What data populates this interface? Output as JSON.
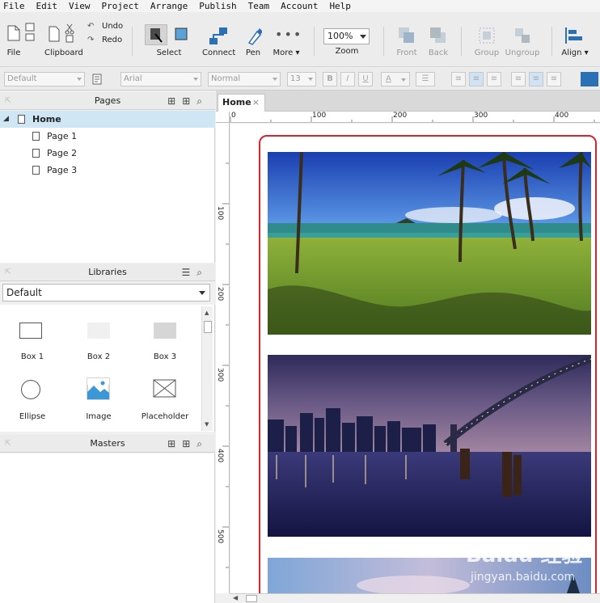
{
  "menu": [
    "File",
    "Edit",
    "View",
    "Project",
    "Arrange",
    "Publish",
    "Team",
    "Account",
    "Help"
  ],
  "toolbar": {
    "file": "File",
    "clipboard": "Clipboard",
    "undo": "Undo",
    "redo": "Redo",
    "select": "Select",
    "connect": "Connect",
    "pen": "Pen",
    "more": "More ▾",
    "zoom_value": "100%",
    "zoom": "Zoom",
    "front": "Front",
    "back": "Back",
    "group": "Group",
    "ungroup": "Ungroup",
    "align": "Align ▾"
  },
  "format": {
    "style": "Default",
    "font": "Arial",
    "weight": "Normal",
    "size": "13",
    "bold": "B",
    "italic": "I",
    "underline": "U",
    "font_color": "A"
  },
  "pages": {
    "title": "Pages",
    "items": [
      {
        "label": "Home",
        "selected": true
      },
      {
        "label": "Page 1"
      },
      {
        "label": "Page 2"
      },
      {
        "label": "Page 3"
      }
    ]
  },
  "libraries": {
    "title": "Libraries",
    "selected": "Default",
    "widgets": [
      "Box 1",
      "Box 2",
      "Box 3",
      "Ellipse",
      "Image",
      "Placeholder"
    ]
  },
  "masters": {
    "title": "Masters"
  },
  "canvas": {
    "tab": "Home",
    "tab_close": "×",
    "ruler_h": [
      "0",
      "100",
      "200",
      "300",
      "400"
    ],
    "ruler_v": [
      "100",
      "200",
      "300",
      "400",
      "500"
    ],
    "photos": [
      "beach-palms",
      "city-bridge-night",
      "sky-partial"
    ]
  },
  "watermark": {
    "brand": "Baidu 经验",
    "url": "jingyan.baidu.com"
  },
  "colors": {
    "selection_frame": "#d9232d",
    "page_selected": "#cfe6f5"
  }
}
